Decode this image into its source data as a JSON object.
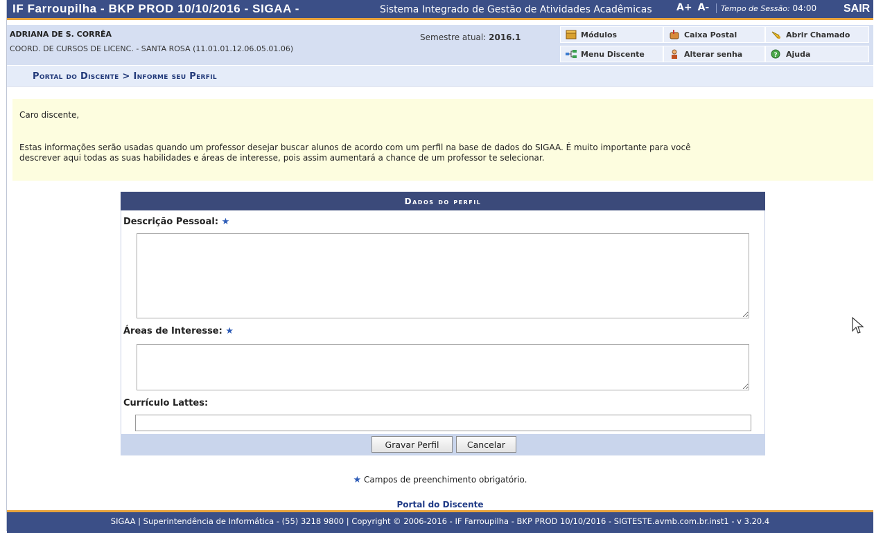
{
  "topbar": {
    "system_title": "IF Farroupilha - BKP PROD 10/10/2016 - SIGAA -",
    "system_subtitle": "Sistema Integrado de Gestão de Atividades Acadêmicas",
    "font_increase": "A+",
    "font_decrease": "A-",
    "session_label": "Tempo de Sessão:",
    "session_time": "04:00",
    "logout": "SAIR"
  },
  "user": {
    "name": "ADRIANA DE S. CORRÊA",
    "unit": "COORD. DE CURSOS DE LICENC. - SANTA ROSA (11.01.01.12.06.05.01.06)",
    "semester_label": "Semestre atual:",
    "semester_value": "2016.1"
  },
  "quick_menu": [
    {
      "label": "Módulos",
      "icon": "modules-box-icon"
    },
    {
      "label": "Caixa Postal",
      "icon": "mailbox-icon"
    },
    {
      "label": "Abrir Chamado",
      "icon": "bell-horn-icon"
    },
    {
      "label": "Menu Discente",
      "icon": "menu-tree-icon"
    },
    {
      "label": "Alterar senha",
      "icon": "user-key-icon"
    },
    {
      "label": "Ajuda",
      "icon": "help-icon"
    }
  ],
  "breadcrumb": "Portal do Discente > Informe seu Perfil",
  "notice": {
    "greeting": "Caro discente,",
    "line1": "Estas informações serão usadas quando um professor desejar buscar alunos de acordo com um perfil na base de dados do SIGAA. É muito importante para você",
    "line2": "descrever aqui todas as suas habilidades e áreas de interesse, pois assim aumentará a chance de um professor te selecionar."
  },
  "form": {
    "title": "Dados do perfil",
    "description_label": "Descrição Pessoal:",
    "description_value": "",
    "interests_label": "Áreas de Interesse:",
    "interests_value": "",
    "lattes_label": "Currículo Lattes:",
    "lattes_value": "",
    "required_marker": "★",
    "save_button": "Gravar Perfil",
    "cancel_button": "Cancelar"
  },
  "required_note": "Campos de preenchimento obrigatório.",
  "portal_link": "Portal do Discente",
  "footer": "SIGAA | Superintendência de Informática - (55) 3218 9800 | Copyright © 2006-2016 - IF Farroupilha - BKP PROD 10/10/2016 - SIGTESTE.avmb.com.br.inst1 - v 3.20.4",
  "colors": {
    "header_blue": "#3b4f87",
    "accent_orange": "#e8a33c",
    "infobar": "#d6dff2",
    "notice_bg": "#fdfddf",
    "form_header": "#3b4a7a",
    "link_blue": "#1f3a86"
  }
}
